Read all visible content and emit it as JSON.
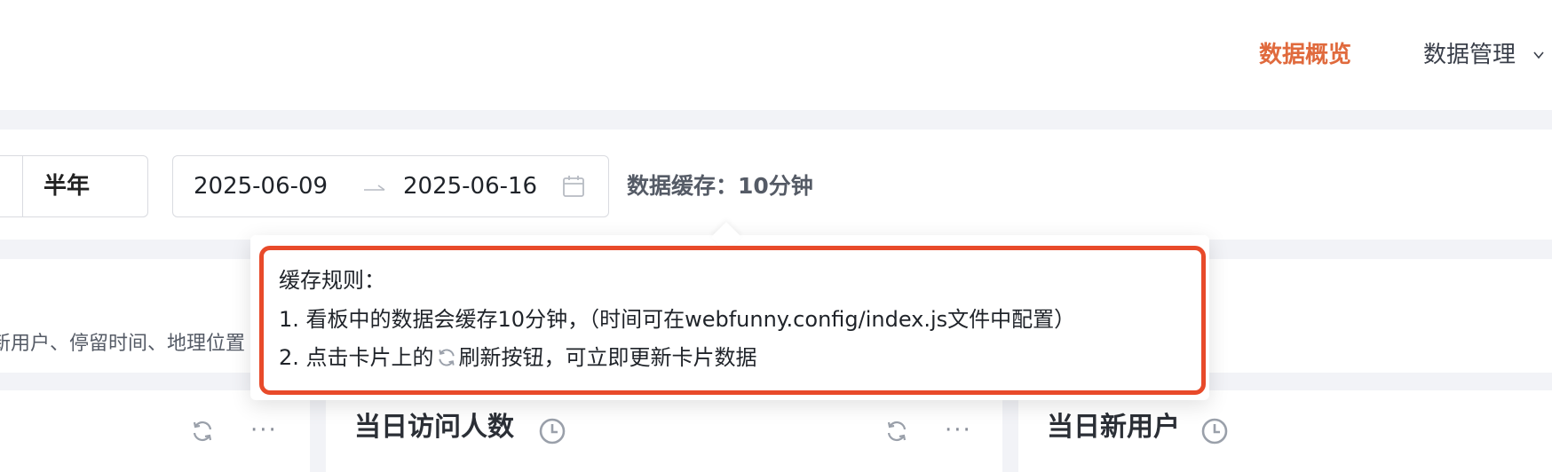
{
  "nav": {
    "active": "数据概览",
    "manage": "数据管理"
  },
  "filters": {
    "half_year": "半年",
    "date_start": "2025-06-09",
    "date_end": "2025-06-16",
    "cache": "数据缓存：10分钟"
  },
  "description": "新用户、停留时间、地理位置",
  "cards": [
    {
      "title": ""
    },
    {
      "title": "当日访问人数"
    },
    {
      "title": "当日新用户"
    }
  ],
  "tooltip": {
    "title": "缓存规则：",
    "rule1": "1. 看板中的数据会缓存10分钟，（时间可在webfunny.config/index.js文件中配置）",
    "rule2_prefix": "2. 点击卡片上的",
    "rule2_suffix": "刷新按钮，可立即更新卡片数据"
  },
  "colors": {
    "accent": "#e06a3d",
    "highlight_border": "#e84a2a",
    "band": "#f2f3f7"
  },
  "icons": [
    "chevron-down-icon",
    "arrow-right-icon",
    "calendar-icon",
    "clock-icon",
    "refresh-icon",
    "more-icon"
  ]
}
